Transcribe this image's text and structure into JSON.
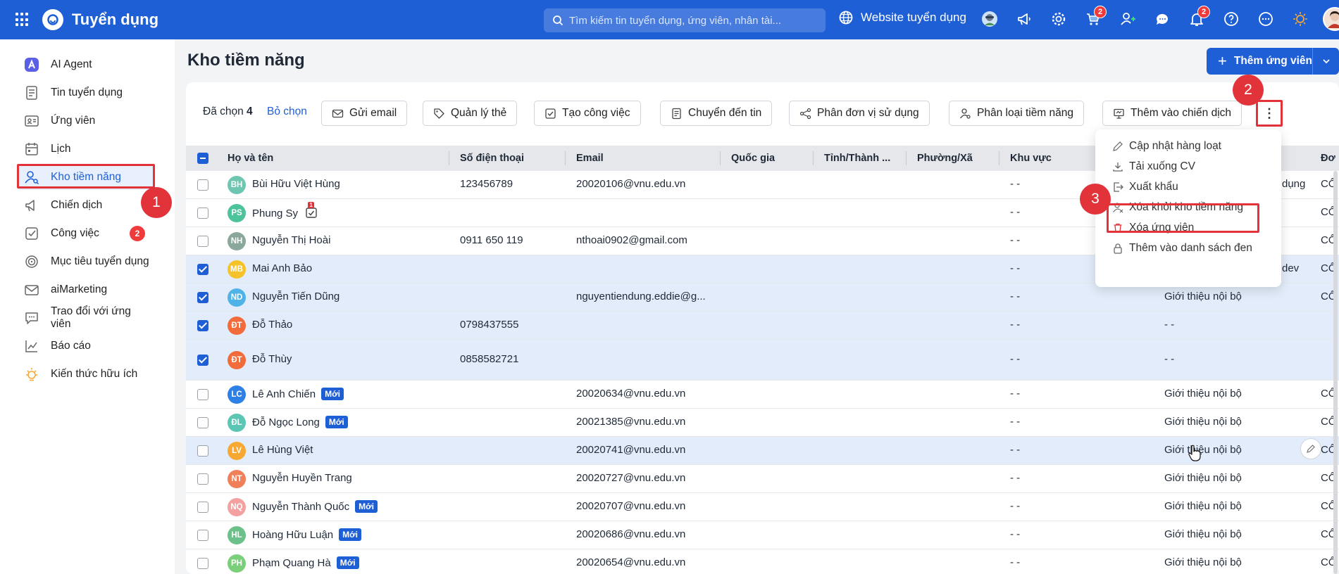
{
  "topbar": {
    "app_title": "Tuyển dụng",
    "search_placeholder": "Tìm kiếm tin tuyển dụng, ứng viên, nhân tài...",
    "website_label": "Website tuyển dụng",
    "cart_badge": "2",
    "bell_badge": "2"
  },
  "sidebar": {
    "items": [
      {
        "label": "AI Agent"
      },
      {
        "label": "Tin tuyển dụng"
      },
      {
        "label": "Ứng viên"
      },
      {
        "label": "Lịch"
      },
      {
        "label": "Kho tiềm năng"
      },
      {
        "label": "Chiến dịch"
      },
      {
        "label": "Công việc",
        "badge": "2"
      },
      {
        "label": "Mục tiêu tuyển dụng"
      },
      {
        "label": "aiMarketing"
      },
      {
        "label": "Trao đổi với ứng viên"
      },
      {
        "label": "Báo cáo"
      },
      {
        "label": "Kiến thức hữu ích"
      }
    ]
  },
  "steps": {
    "one": "1",
    "two": "2",
    "three": "3"
  },
  "page": {
    "title": "Kho tiềm năng",
    "add_button": "Thêm ứng viên"
  },
  "toolbar": {
    "selected_label": "Đã chọn",
    "selected_count": "4",
    "deselect": "Bỏ chọn",
    "send_email": "Gửi email",
    "manage_tags": "Quản lý thẻ",
    "create_task": "Tạo công việc",
    "move_to_job": "Chuyển đến tin",
    "assign_unit": "Phân đơn vị sử dụng",
    "classify": "Phân loại tiềm năng",
    "add_campaign": "Thêm vào chiến dịch",
    "more": "⋮"
  },
  "menu": {
    "bulk_update": "Cập nhật hàng loạt",
    "download_cv": "Tải xuống CV",
    "export": "Xuất khẩu",
    "remove_pool": "Xóa khỏi kho tiềm năng",
    "delete_candidate": "Xóa ứng viên",
    "blacklist": "Thêm vào danh sách đen"
  },
  "table": {
    "columns": [
      "Họ và tên",
      "Số điện thoại",
      "Email",
      "Quốc gia",
      "Tỉnh/Thành ...",
      "Phường/Xã",
      "Khu vực",
      "Đơ"
    ],
    "new_tag": "Mới",
    "rows": [
      {
        "initials": "BH",
        "color": "#6ec6b0",
        "name": "Bùi Hữu Việt Hùng",
        "phone": "123456789",
        "email": "20020106@vnu.edu.vn",
        "area": "- -",
        "source": "",
        "extra": "dụng",
        "last": "CỔ",
        "checked": false
      },
      {
        "initials": "PS",
        "color": "#4cc39a",
        "name": "Phung Sy",
        "phone": "",
        "email": "",
        "area": "- -",
        "source": "",
        "extra": "",
        "last": "CỔ",
        "checked": false,
        "task": "1"
      },
      {
        "initials": "NH",
        "color": "#8aa89a",
        "name": "Nguyễn Thị Hoài",
        "phone": "0911 650 119",
        "email": "nthoai0902@gmail.com",
        "area": "- -",
        "source": "",
        "extra": "",
        "last": "CỔ",
        "checked": false
      },
      {
        "initials": "MB",
        "color": "#f6c22a",
        "name": "Mai Anh Bảo",
        "phone": "",
        "email": "",
        "area": "- -",
        "source": "",
        "extra": "dev",
        "last": "CỔ",
        "checked": true
      },
      {
        "initials": "ND",
        "color": "#4fb3e8",
        "name": "Nguyễn Tiến Dũng",
        "phone": "",
        "email": "nguyentiendung.eddie@g...",
        "area": "- -",
        "source": "Giới thiệu nội bộ",
        "extra": "",
        "last": "CỔ",
        "checked": true
      },
      {
        "initials": "ĐT",
        "color": "#f26b3a",
        "name": "Đỗ Thảo",
        "phone": "0798437555",
        "email": "",
        "area": "- -",
        "source": "- -",
        "extra": "",
        "last": "",
        "checked": true
      },
      {
        "initials": "ĐT",
        "color": "#f26b3a",
        "name": "Đỗ Thùy",
        "phone": "0858582721",
        "email": "",
        "area": "- -",
        "source": "- -",
        "extra": "",
        "last": "",
        "checked": true
      },
      {
        "initials": "LC",
        "color": "#2f80e6",
        "name": "Lê Anh Chiến",
        "phone": "",
        "email": "20020634@vnu.edu.vn",
        "area": "- -",
        "source": "Giới thiệu nội bộ",
        "extra": "",
        "last": "CỔ",
        "checked": false,
        "is_new": true
      },
      {
        "initials": "ĐL",
        "color": "#5cc6b4",
        "name": "Đỗ Ngọc Long",
        "phone": "",
        "email": "20021385@vnu.edu.vn",
        "area": "- -",
        "source": "Giới thiệu nội bộ",
        "extra": "",
        "last": "CỔ",
        "checked": false,
        "is_new": true
      },
      {
        "initials": "LV",
        "color": "#f7a833",
        "name": "Lê Hùng Việt",
        "phone": "",
        "email": "20020741@vnu.edu.vn",
        "area": "- -",
        "source": "Giới thiệu nội bộ",
        "extra": "",
        "last": "CỔ",
        "checked": false
      },
      {
        "initials": "NT",
        "color": "#f07f5a",
        "name": "Nguyễn Huyền Trang",
        "phone": "",
        "email": "20020727@vnu.edu.vn",
        "area": "- -",
        "source": "Giới thiệu nội bộ",
        "extra": "",
        "last": "CỔ",
        "checked": false
      },
      {
        "initials": "NQ",
        "color": "#f4a0a0",
        "name": "Nguyễn Thành Quốc",
        "phone": "",
        "email": "20020707@vnu.edu.vn",
        "area": "- -",
        "source": "Giới thiệu nội bộ",
        "extra": "",
        "last": "CỔ",
        "checked": false,
        "is_new": true
      },
      {
        "initials": "HL",
        "color": "#6cc18a",
        "name": "Hoàng Hữu Luận",
        "phone": "",
        "email": "20020686@vnu.edu.vn",
        "area": "- -",
        "source": "Giới thiệu nội bộ",
        "extra": "",
        "last": "CỔ",
        "checked": false,
        "is_new": true
      },
      {
        "initials": "PH",
        "color": "#7ccf7a",
        "name": "Phạm Quang Hà",
        "phone": "",
        "email": "20020654@vnu.edu.vn",
        "area": "- -",
        "source": "Giới thiệu nội bộ",
        "extra": "",
        "last": "CỔ",
        "checked": false,
        "is_new": true
      }
    ]
  },
  "colors": {
    "brand": "#1f5fd6",
    "highlight": "#e2333b",
    "selected_row": "#e3ecfa"
  }
}
